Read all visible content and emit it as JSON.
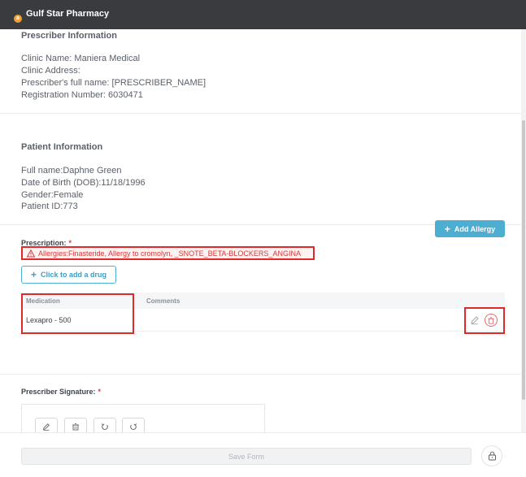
{
  "app": {
    "brand_name": "Gulf Star Pharmacy",
    "brand_initial": "a"
  },
  "prescriber": {
    "title": "Prescriber Information",
    "clinic_name": "Clinic Name: Maniera Medical",
    "clinic_address": "Clinic Address:",
    "full_name": "Prescriber's full name: [PRESCRIBER_NAME]",
    "registration": "Registration Number: 6030471"
  },
  "patient": {
    "title": "Patient Information",
    "full_name": "Full name:Daphne Green",
    "dob": "Date of Birth (DOB):11/18/1996",
    "gender": "Gender:Female",
    "patient_id": "Patient ID:773"
  },
  "prescription": {
    "label": "Prescription:",
    "required_mark": "*",
    "add_allergy_label": "Add Allergy",
    "allergies_text": "Allergies:Finasteride, Allergy to cromolyn, _SNOTE_BETA-BLOCKERS_ANGINA",
    "add_drug_label": "Click to add a drug",
    "table": {
      "columns": [
        "Medication",
        "Comments"
      ],
      "rows": [
        {
          "medication": "Lexapro - 500",
          "comments": ""
        }
      ]
    }
  },
  "signature": {
    "label": "Prescriber Signature:",
    "required_mark": "*"
  },
  "footer": {
    "save_label": "Save Form"
  },
  "colors": {
    "topbar": "#3a3b3f",
    "accent": "#4eaed2",
    "danger": "#e02a2a"
  },
  "icons": [
    "warning-icon",
    "plus-icon",
    "pencil-icon",
    "trash-icon",
    "undo-icon",
    "redo-icon",
    "lock-icon"
  ]
}
